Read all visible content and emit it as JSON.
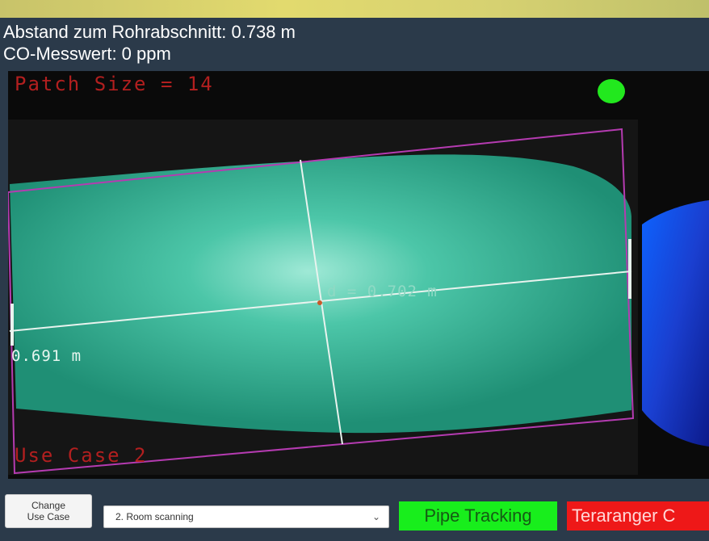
{
  "info": {
    "distance_line": "Abstand zum Rohrabschnitt: 0.738 m",
    "co_line": "CO-Messwert: 0 ppm"
  },
  "camera": {
    "patch_size_label": "Patch Size = 14",
    "use_case_label": "Use Case 2",
    "distance_d_label": "d = 0.702 m",
    "distance_side_label": "0.691 m",
    "status_dot_color": "#22e81e",
    "overlay_color": "#b21f1f",
    "region_color": "#2fae8c"
  },
  "controls": {
    "change_use_case_line1": "Change",
    "change_use_case_line2": "Use Case",
    "use_case_selected": "2. Room scanning",
    "pipe_tracking_label": "Pipe Tracking",
    "pipe_tracking_color": "#18ee1c",
    "teraranger_label": "Teraranger C",
    "teraranger_color": "#ee1818"
  }
}
